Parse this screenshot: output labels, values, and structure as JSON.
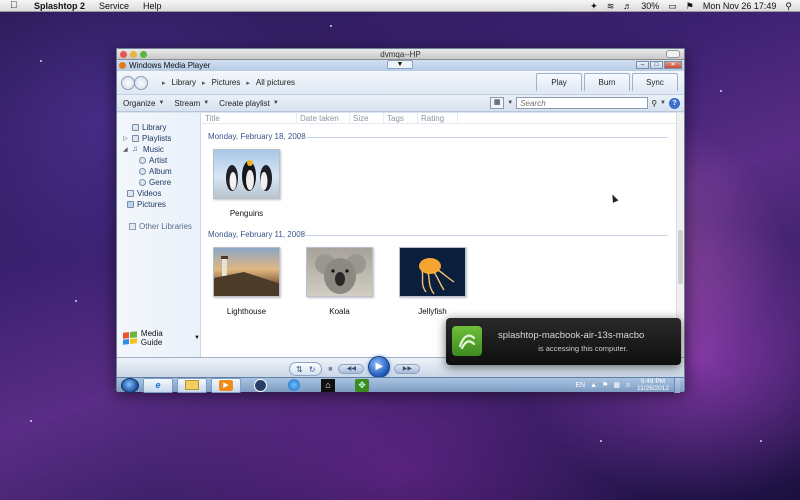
{
  "menubar": {
    "app_name": "Splashtop 2",
    "items": [
      "Service",
      "Help"
    ],
    "battery": "30%",
    "clock": "Mon Nov 26  17:49"
  },
  "window": {
    "mac_title": "dvmqa--HP",
    "app_title": "Windows Media Player"
  },
  "nav": {
    "breadcrumbs": [
      "Library",
      "Pictures",
      "All pictures"
    ],
    "tabs": [
      "Play",
      "Burn",
      "Sync"
    ]
  },
  "toolbar": {
    "organize": "Organize",
    "stream": "Stream",
    "create_playlist": "Create playlist",
    "search_placeholder": "Search"
  },
  "sidebar": {
    "items": [
      {
        "label": "Library",
        "level": 0
      },
      {
        "label": "Playlists",
        "level": 0
      },
      {
        "label": "Music",
        "level": 0
      },
      {
        "label": "Artist",
        "level": 1
      },
      {
        "label": "Album",
        "level": 1
      },
      {
        "label": "Genre",
        "level": 1
      },
      {
        "label": "Videos",
        "level": 0
      },
      {
        "label": "Pictures",
        "level": 0
      }
    ],
    "other_libraries": "Other Libraries",
    "media_guide": "Media Guide"
  },
  "columns": [
    "Title",
    "Date taken",
    "Size",
    "Tags",
    "Rating"
  ],
  "groups": [
    {
      "date": "Monday, February 18, 2008",
      "items": [
        "Penguins"
      ]
    },
    {
      "date": "Monday, February 11, 2008",
      "items": [
        "Lighthouse",
        "Koala",
        "Jellyfish"
      ]
    }
  ],
  "tray": {
    "language": "EN",
    "time": "5:49 PM",
    "date": "11/26/2012"
  },
  "notification": {
    "title": "splashtop-macbook-air-13s-macbo",
    "message": "is accessing this computer."
  }
}
